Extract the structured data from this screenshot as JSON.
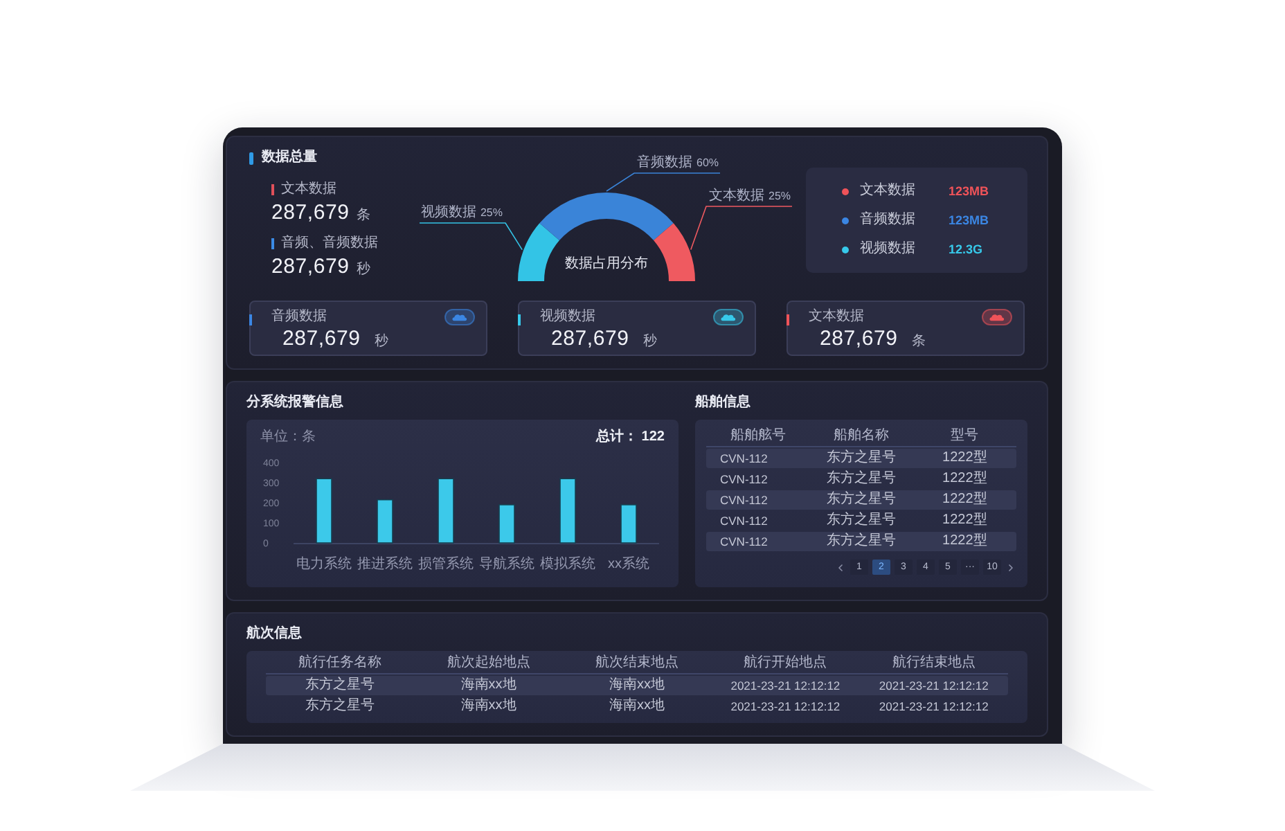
{
  "overview": {
    "title": "数据总量",
    "stats": [
      {
        "label": "文本数据",
        "value": "287,679",
        "unit": "条",
        "color": "#e0505a"
      },
      {
        "label": "音频、音频数据",
        "value": "287,679",
        "unit": "秒",
        "color": "#3b8be6"
      }
    ],
    "chart_data": {
      "type": "donut",
      "title": "数据占用分布",
      "categories": [
        "视频数据",
        "音频数据",
        "文本数据"
      ],
      "values": [
        25,
        60,
        25
      ],
      "value_labels": [
        "25%",
        "60%",
        "25%"
      ]
    },
    "legend": [
      {
        "label": "文本数据",
        "value": "123MB",
        "color": "#ef5359"
      },
      {
        "label": "音频数据",
        "value": "123MB",
        "color": "#3b86e3"
      },
      {
        "label": "视频数据",
        "value": "12.3G",
        "color": "#37c9ea"
      }
    ],
    "cards": [
      {
        "label": "音频数据",
        "value": "287,679",
        "unit": "秒",
        "color": "#3b86e3"
      },
      {
        "label": "视频数据",
        "value": "287,679",
        "unit": "秒",
        "color": "#37c9ea"
      },
      {
        "label": "文本数据",
        "value": "287,679",
        "unit": "条",
        "color": "#ef5359"
      }
    ]
  },
  "alarms": {
    "title": "分系统报警信息",
    "total": "总计： 122",
    "chart_data": {
      "type": "bar",
      "ylabel": "单位：条",
      "categories": [
        "电力系统",
        "推进系统",
        "损管系统",
        "导航系统",
        "模拟系统",
        "xx系统"
      ],
      "values": [
        320,
        215,
        320,
        190,
        320,
        190
      ],
      "ylim": [
        0,
        400
      ],
      "yticks": [
        0,
        100,
        200,
        300,
        400
      ]
    }
  },
  "ships": {
    "title": "船舶信息",
    "columns": [
      "船舶舷号",
      "船舶名称",
      "型号"
    ],
    "rows": [
      [
        "CVN-112",
        "东方之星号",
        "1222型"
      ],
      [
        "CVN-112",
        "东方之星号",
        "1222型"
      ],
      [
        "CVN-112",
        "东方之星号",
        "1222型"
      ],
      [
        "CVN-112",
        "东方之星号",
        "1222型"
      ],
      [
        "CVN-112",
        "东方之星号",
        "1222型"
      ]
    ],
    "pagination": [
      {
        "label": "1",
        "selected": false
      },
      {
        "label": "2",
        "selected": true
      },
      {
        "label": "3",
        "selected": false
      },
      {
        "label": "4",
        "selected": false
      },
      {
        "label": "5",
        "selected": false
      },
      {
        "label": "···",
        "selected": false
      },
      {
        "label": "10",
        "selected": false
      }
    ]
  },
  "voyages": {
    "title": "航次信息",
    "columns": [
      "航行任务名称",
      "航次起始地点",
      "航次结束地点",
      "航行开始地点",
      "航行结束地点"
    ],
    "rows": [
      [
        "东方之星号",
        "海南xx地",
        "海南xx地",
        "2021-23-21 12:12:12",
        "2021-23-21 12:12:12"
      ],
      [
        "东方之星号",
        "海南xx地",
        "海南xx地",
        "2021-23-21 12:12:12",
        "2021-23-21 12:12:12"
      ]
    ]
  }
}
